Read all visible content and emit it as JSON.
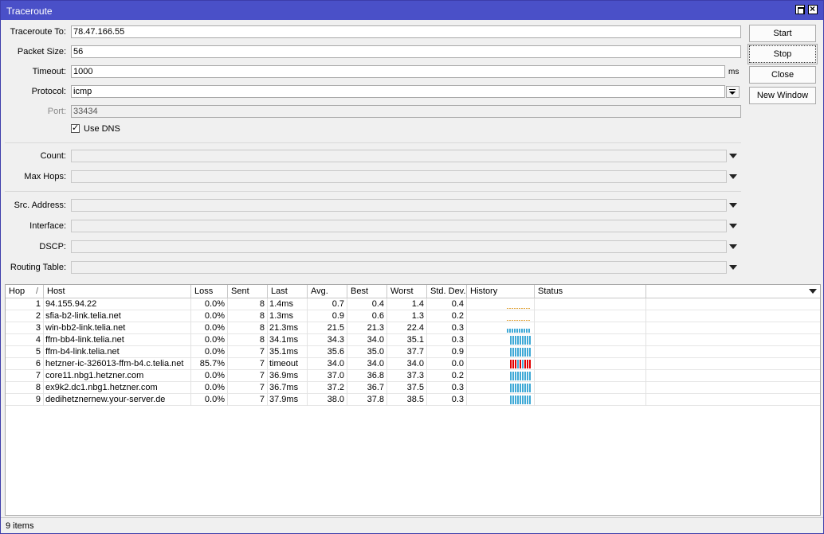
{
  "window": {
    "title": "Traceroute"
  },
  "form": {
    "traceroute_to_label": "Traceroute To:",
    "traceroute_to": "78.47.166.55",
    "packet_size_label": "Packet Size:",
    "packet_size": "56",
    "timeout_label": "Timeout:",
    "timeout": "1000",
    "timeout_unit": "ms",
    "protocol_label": "Protocol:",
    "protocol": "icmp",
    "port_label": "Port:",
    "port": "33434",
    "use_dns_label": "Use DNS",
    "use_dns_checked": true,
    "count_label": "Count:",
    "max_hops_label": "Max Hops:",
    "src_address_label": "Src. Address:",
    "interface_label": "Interface:",
    "dscp_label": "DSCP:",
    "routing_table_label": "Routing Table:"
  },
  "buttons": {
    "start": "Start",
    "stop": "Stop",
    "close": "Close",
    "new_window": "New Window"
  },
  "table": {
    "columns": [
      "Hop",
      "Host",
      "Loss",
      "Sent",
      "Last",
      "Avg.",
      "Best",
      "Worst",
      "Std. Dev.",
      "History",
      "Status"
    ],
    "sort_indicator": "/",
    "rows": [
      {
        "hop": "1",
        "host": "94.155.94.22",
        "loss": "0.0%",
        "sent": "8",
        "last": "1.4ms",
        "avg": "0.7",
        "best": "0.4",
        "worst": "1.4",
        "std": "0.4",
        "history": "low"
      },
      {
        "hop": "2",
        "host": "sfia-b2-link.telia.net",
        "loss": "0.0%",
        "sent": "8",
        "last": "1.3ms",
        "avg": "0.9",
        "best": "0.6",
        "worst": "1.3",
        "std": "0.2",
        "history": "low"
      },
      {
        "hop": "3",
        "host": "win-bb2-link.telia.net",
        "loss": "0.0%",
        "sent": "8",
        "last": "21.3ms",
        "avg": "21.5",
        "best": "21.3",
        "worst": "22.4",
        "std": "0.3",
        "history": "mid"
      },
      {
        "hop": "4",
        "host": "ffm-bb4-link.telia.net",
        "loss": "0.0%",
        "sent": "8",
        "last": "34.1ms",
        "avg": "34.3",
        "best": "34.0",
        "worst": "35.1",
        "std": "0.3",
        "history": "high"
      },
      {
        "hop": "5",
        "host": "ffm-b4-link.telia.net",
        "loss": "0.0%",
        "sent": "7",
        "last": "35.1ms",
        "avg": "35.6",
        "best": "35.0",
        "worst": "37.7",
        "std": "0.9",
        "history": "high"
      },
      {
        "hop": "6",
        "host": "hetzner-ic-326013-ffm-b4.c.telia.net",
        "loss": "85.7%",
        "sent": "7",
        "last": "timeout",
        "avg": "34.0",
        "best": "34.0",
        "worst": "34.0",
        "std": "0.0",
        "history": "loss"
      },
      {
        "hop": "7",
        "host": "core11.nbg1.hetzner.com",
        "loss": "0.0%",
        "sent": "7",
        "last": "36.9ms",
        "avg": "37.0",
        "best": "36.8",
        "worst": "37.3",
        "std": "0.2",
        "history": "high"
      },
      {
        "hop": "8",
        "host": "ex9k2.dc1.nbg1.hetzner.com",
        "loss": "0.0%",
        "sent": "7",
        "last": "36.7ms",
        "avg": "37.2",
        "best": "36.7",
        "worst": "37.5",
        "std": "0.3",
        "history": "high"
      },
      {
        "hop": "9",
        "host": "dedihetznernew.your-server.de",
        "loss": "0.0%",
        "sent": "7",
        "last": "37.9ms",
        "avg": "38.0",
        "best": "37.8",
        "worst": "38.5",
        "std": "0.3",
        "history": "high"
      }
    ]
  },
  "colors": {
    "history_ok": "#3fa9d6",
    "history_loss": "#e00000",
    "history_low": "#e0a030",
    "titlebar": "#4a50c8"
  },
  "status": {
    "items": "9 items"
  }
}
